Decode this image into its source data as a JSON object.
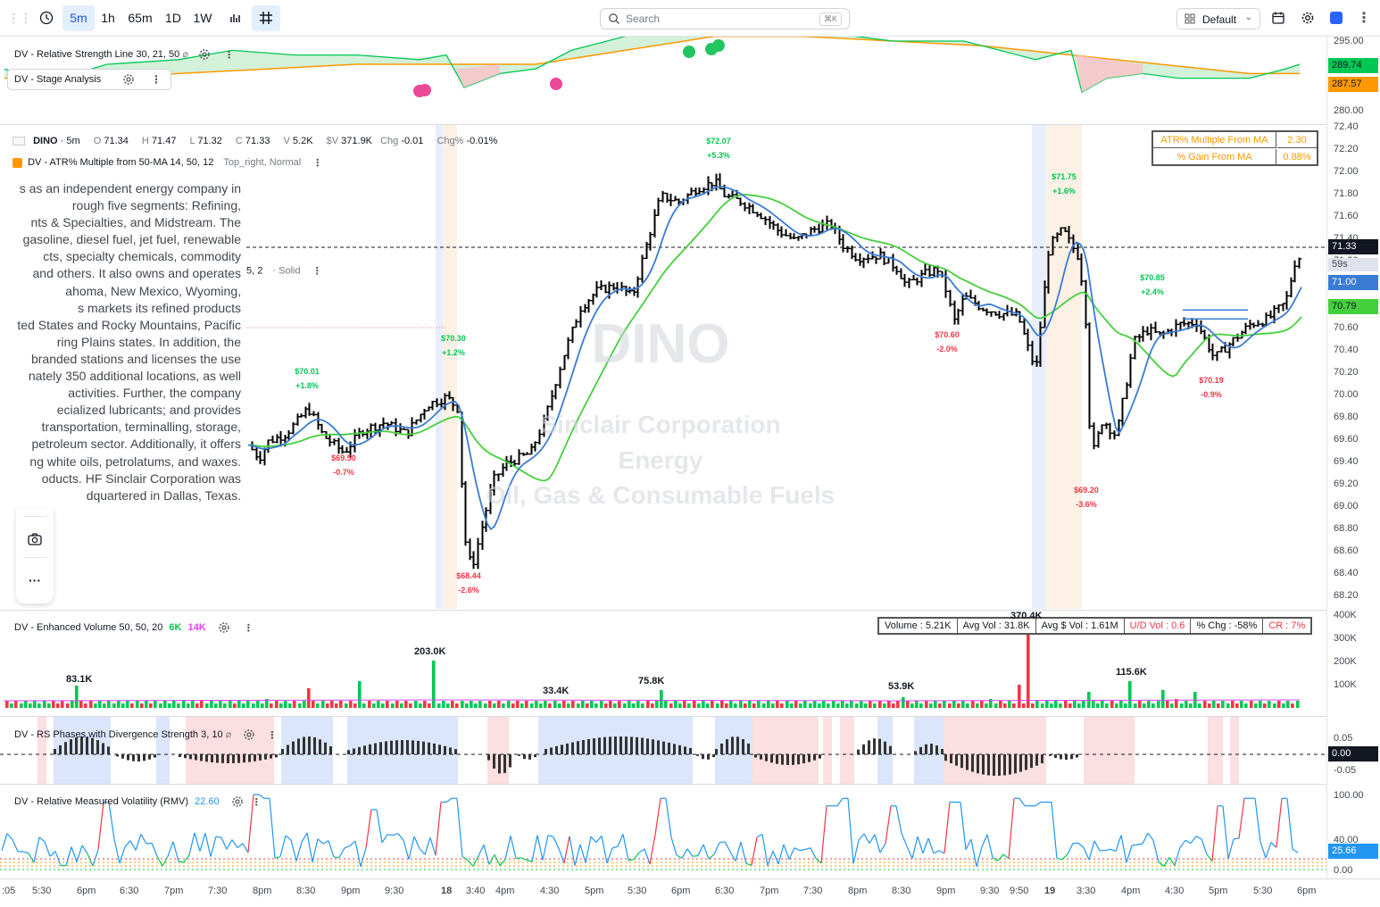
{
  "toolbar": {
    "intervals": [
      "5m",
      "1h",
      "65m",
      "1D",
      "1W"
    ],
    "active_interval": "5m",
    "search_placeholder": "Search",
    "search_shortcut": "⌘K",
    "layout_label": "Default"
  },
  "colors": {
    "up": "#00c853",
    "down": "#f23645",
    "ema_blue": "#3a7bd5",
    "sma_green": "#44d03c",
    "accent": "#2962ff"
  },
  "rs_pane": {
    "title": "DV - Relative Strength Line 30, 21, 50",
    "sub_title": "DV - Stage Analysis",
    "axis": [
      "295.00",
      "280.00"
    ],
    "tags": [
      {
        "value": "289.74",
        "color": "#00c853"
      },
      {
        "value": "287.57",
        "color": "#ff9800"
      }
    ]
  },
  "main": {
    "symbol": "DINO",
    "interval": "5m",
    "o_label": "O",
    "o": "71.34",
    "h_label": "H",
    "h": "71.47",
    "l_label": "L",
    "l": "71.32",
    "c_label": "C",
    "c": "71.33",
    "v_label": "V",
    "v": "5.2K",
    "dv_label": "$V",
    "dv": "371.9K",
    "chg_label": "Chg",
    "chg": "-0.01",
    "chgp_label": "Chg%",
    "chgp": "-0.01%",
    "atr_indicator": "DV - ATR% Multiple from 50-MA 14, 50, 12",
    "atr_opts": "Top_right, Normal",
    "hidden_indicator": "5, 2",
    "hidden_indicator_opts": "Solid",
    "description": "s as an independent energy company in rough five segments: Refining, nts & Specialties, and Midstream. The gasoline, diesel fuel, jet fuel, renewable cts, specialty chemicals, commodity and others. It also owns and operates ahoma, New Mexico, Wyoming, s markets its refined products ted States and Rocky Mountains, Pacific ring Plains states. In addition, the branded stations and licenses the use nately 350 additional locations, as well activities. Further, the company ecialized lubricants; and provides transportation, terminalling, storage, petroleum sector. Additionally, it offers ng white oils, petrolatums, and waxes. oducts. HF Sinclair Corporation was dquartered in Dallas, Texas.",
    "description_lines": [
      "s as an independent energy company in",
      "rough five segments: Refining,",
      "nts & Specialties, and Midstream. The",
      "gasoline, diesel fuel, jet fuel, renewable",
      "cts, specialty chemicals, commodity",
      "and others. It also owns and operates",
      "ahoma, New Mexico, Wyoming,",
      "s markets its refined products",
      "ted States and Rocky Mountains, Pacific",
      "ring Plains states. In addition, the",
      "branded stations and licenses the use",
      "nately 350 additional locations, as well",
      "activities. Further, the company",
      "ecialized lubricants; and provides",
      "transportation, terminalling, storage,",
      "petroleum sector. Additionally, it offers",
      "ng white oils, petrolatums, and waxes.",
      "oducts. HF Sinclair Corporation was",
      "dquartered in Dallas, Texas."
    ],
    "watermark": {
      "ticker": "DINO",
      "company": "Sinclair Corporation",
      "sector": "Energy",
      "industry": "Oil, Gas & Consumable Fuels"
    },
    "atr_table": [
      {
        "label": "ATR% Multiple From MA",
        "value": "2.30"
      },
      {
        "label": "% Gain From MA",
        "value": "0.88%"
      }
    ],
    "price_axis": [
      "72.40",
      "72.20",
      "72.00",
      "71.80",
      "71.60",
      "71.40",
      "71.20",
      "71.00",
      "70.80",
      "70.60",
      "70.40",
      "70.20",
      "70.00",
      "69.80",
      "69.60",
      "69.40",
      "69.20",
      "69.00",
      "68.80",
      "68.60",
      "68.40",
      "68.20"
    ],
    "last_price": "71.33",
    "countdown": "59s",
    "ema_value": "71.00",
    "sma_value": "70.79",
    "swings": [
      {
        "price": "$70.01",
        "pct": "+1.8%",
        "up": true
      },
      {
        "price": "$69.50",
        "pct": "-0.7%",
        "up": false
      },
      {
        "price": "$70.30",
        "pct": "+1.2%",
        "up": true
      },
      {
        "price": "$68.44",
        "pct": "-2.6%",
        "up": false
      },
      {
        "price": "$72.07",
        "pct": "+5.3%",
        "up": true
      },
      {
        "price": "$70.60",
        "pct": "-2.0%",
        "up": false
      },
      {
        "price": "$71.75",
        "pct": "+1.6%",
        "up": true
      },
      {
        "price": "$69.20",
        "pct": "-3.6%",
        "up": false
      },
      {
        "price": "$70.85",
        "pct": "+2.4%",
        "up": true
      },
      {
        "price": "$70.19",
        "pct": "-0.9%",
        "up": false
      }
    ]
  },
  "volume_pane": {
    "title": "DV - Enhanced Volume 50, 50, 20",
    "v1": "6K",
    "v2": "14K",
    "info_bar": [
      "Volume : 5.21K",
      "Avg Vol : 31.8K",
      "Avg $ Vol : 1.61M",
      "U/D Vol : 0.6",
      "% Chg : -58%",
      "CR : 7%"
    ],
    "axis": [
      "400K",
      "300K",
      "200K",
      "100K"
    ],
    "labels": [
      "83.1K",
      "203.0K",
      "33.4K",
      "75.8K",
      "53.9K",
      "370.4K",
      "115.6K"
    ]
  },
  "phases_pane": {
    "title": "DV - RS Phases with Divergence Strength 3, 10",
    "axis": [
      "0.05",
      "-0.05"
    ],
    "tag": "0.00"
  },
  "rmv_pane": {
    "title": "DV - Relative Measured Volatility (RMV)",
    "value": "22.60",
    "axis": [
      "100.00",
      "40.00",
      "0.00"
    ],
    "tag": "25.66"
  },
  "time_axis": [
    ":05",
    "5:30",
    "6pm",
    "6:30",
    "7pm",
    "7:30",
    "8pm",
    "8:30",
    "9pm",
    "9:30",
    "18",
    "3:40",
    "4pm",
    "4:30",
    "5pm",
    "5:30",
    "6pm",
    "6:30",
    "7pm",
    "7:30",
    "8pm",
    "8:30",
    "9pm",
    "9:30",
    "9:50",
    "19",
    "3:30",
    "4pm",
    "4:30",
    "5pm",
    "5:30",
    "6pm"
  ]
}
